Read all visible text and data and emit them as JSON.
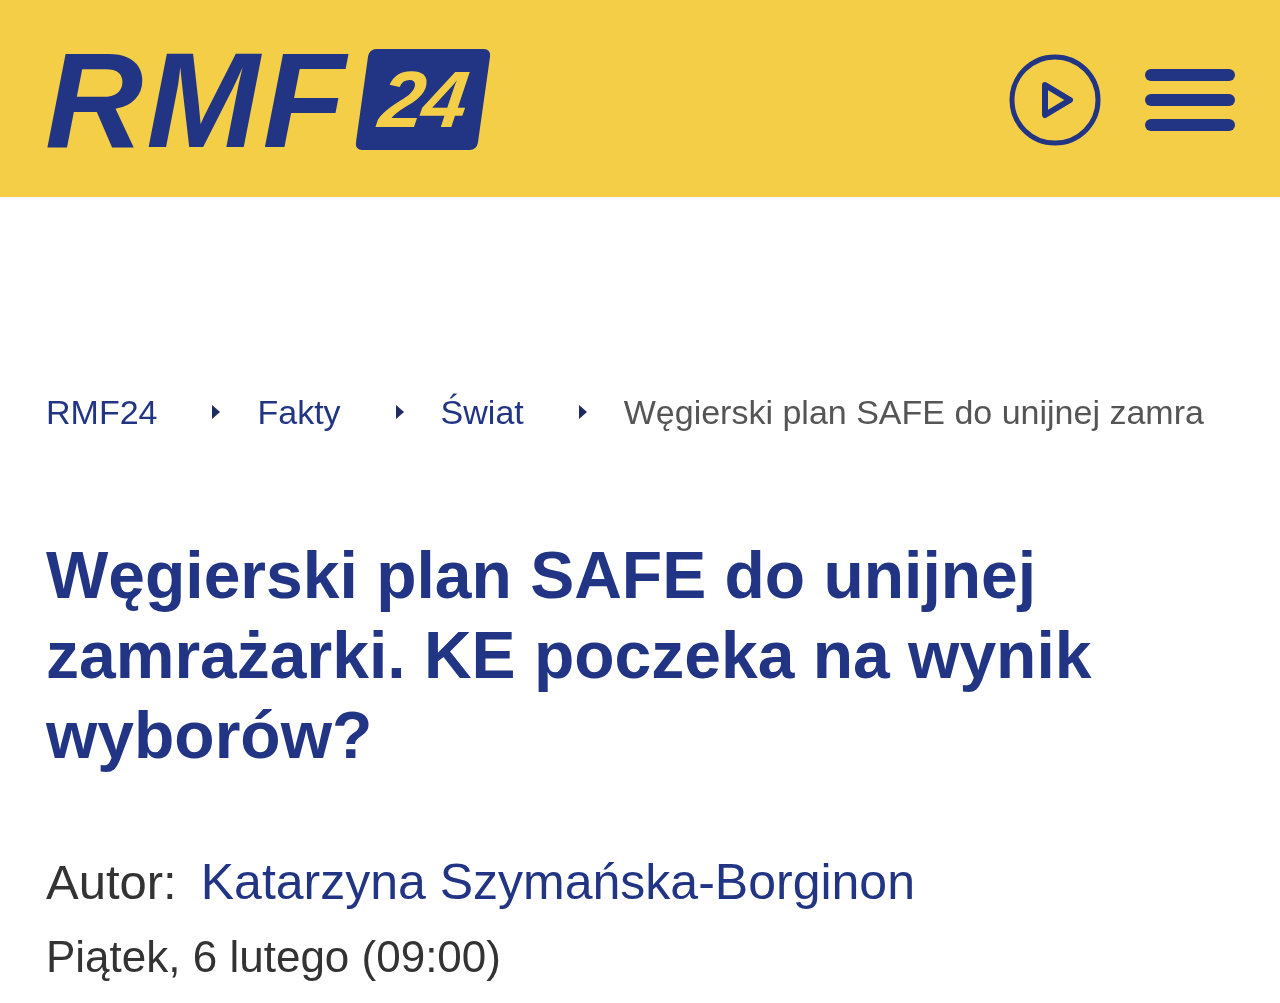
{
  "header": {
    "logo": {
      "text": "RMF",
      "badge": "24"
    }
  },
  "breadcrumb": [
    {
      "label": "RMF24",
      "current": false
    },
    {
      "label": "Fakty",
      "current": false
    },
    {
      "label": "Świat",
      "current": false
    },
    {
      "label": "Węgierski plan SAFE do unijnej zamra",
      "current": true
    }
  ],
  "article": {
    "title": "Węgierski plan SAFE do unijnej zamrażarki. KE poczeka na wynik wyborów?",
    "author_label": "Autor:",
    "author": "Katarzyna Szymańska-Borginon",
    "date": "Piątek, 6 lutego (09:00)"
  }
}
